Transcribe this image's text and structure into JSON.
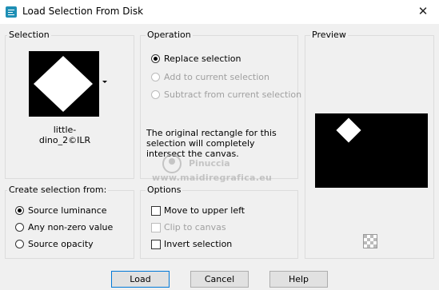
{
  "window": {
    "title": "Load Selection From Disk",
    "close_glyph": "✕"
  },
  "selection_group": {
    "label": "Selection",
    "file_name": "little-dino_2©ILR"
  },
  "operation_group": {
    "label": "Operation",
    "options": [
      {
        "label": "Replace selection",
        "selected": true,
        "enabled": true
      },
      {
        "label": "Add to current selection",
        "selected": false,
        "enabled": false
      },
      {
        "label": "Subtract from current selection",
        "selected": false,
        "enabled": false
      }
    ],
    "info_text": "The original rectangle for this selection will completely intersect the canvas."
  },
  "preview_group": {
    "label": "Preview"
  },
  "create_group": {
    "label": "Create selection from:",
    "options": [
      {
        "label": "Source luminance",
        "selected": true
      },
      {
        "label": "Any non-zero value",
        "selected": false
      },
      {
        "label": "Source opacity",
        "selected": false
      }
    ]
  },
  "options_group": {
    "label": "Options",
    "items": [
      {
        "label": "Move to upper left",
        "checked": false,
        "enabled": true
      },
      {
        "label": "Clip to canvas",
        "checked": false,
        "enabled": false
      },
      {
        "label": "Invert selection",
        "checked": false,
        "enabled": true
      }
    ]
  },
  "watermark": {
    "name": "Pinuccia",
    "site": "www.maidiregrafica.eu"
  },
  "buttons": {
    "load": "Load",
    "cancel": "Cancel",
    "help": "Help"
  },
  "colors": {
    "accent": "#0078d7",
    "app_icon": "#1e8fb5"
  }
}
